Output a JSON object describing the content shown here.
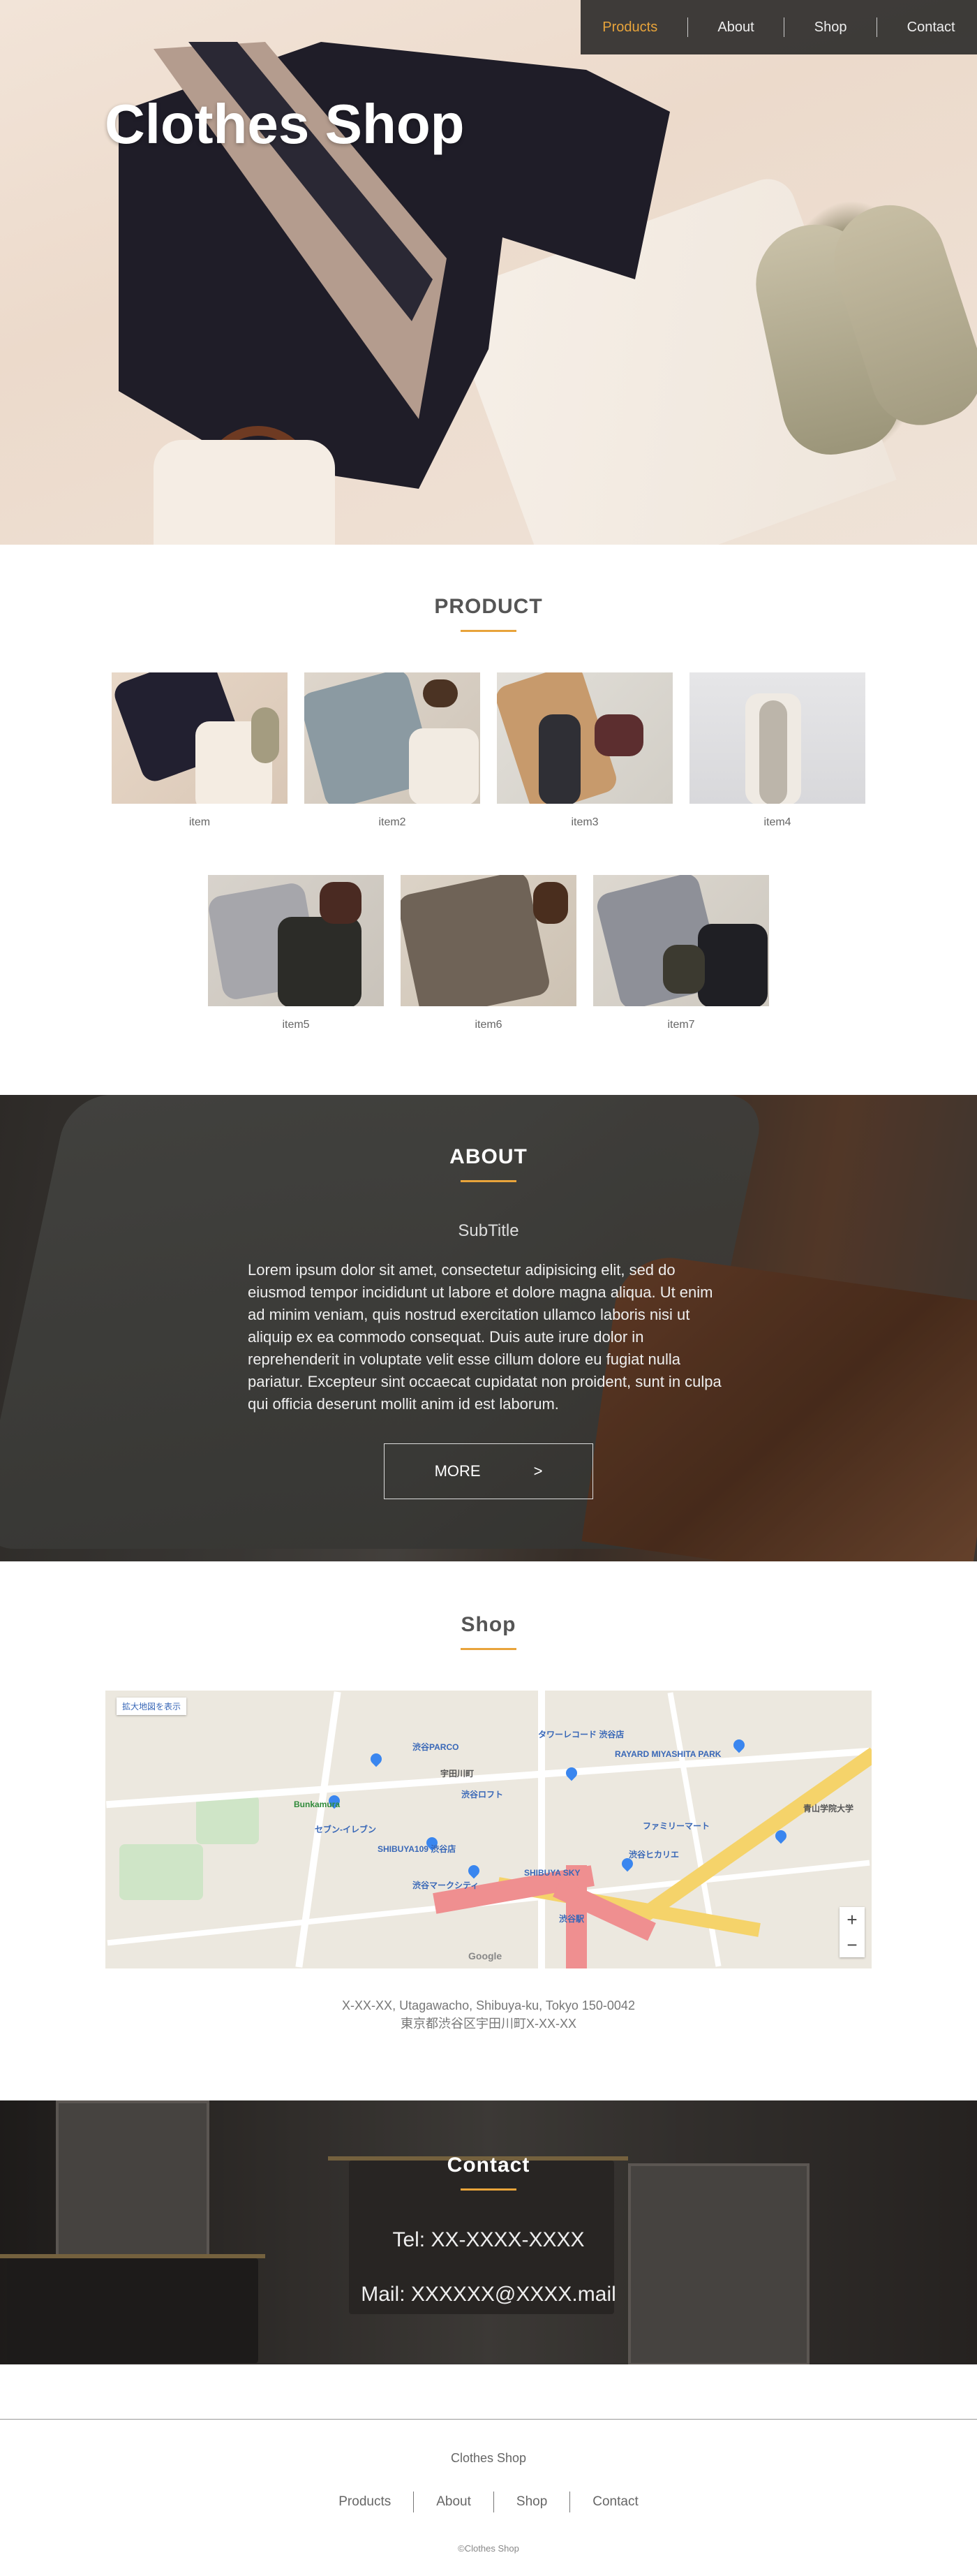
{
  "hero": {
    "title": "Clothes Shop"
  },
  "nav": {
    "items": [
      {
        "label": "Products",
        "active": true
      },
      {
        "label": "About",
        "active": false
      },
      {
        "label": "Shop",
        "active": false
      },
      {
        "label": "Contact",
        "active": false
      }
    ]
  },
  "product": {
    "title": "PRODUCT",
    "items": [
      {
        "caption": "item"
      },
      {
        "caption": "item2"
      },
      {
        "caption": "item3"
      },
      {
        "caption": "item4"
      },
      {
        "caption": "item5"
      },
      {
        "caption": "item6"
      },
      {
        "caption": "item7"
      }
    ]
  },
  "about": {
    "title": "ABOUT",
    "subtitle": "SubTitle",
    "body": "Lorem ipsum dolor sit amet, consectetur adipisicing elit, sed do eiusmod tempor incididunt ut labore et dolore magna aliqua. Ut enim ad minim veniam, quis nostrud exercitation ullamco laboris nisi ut aliquip ex ea commodo consequat. Duis aute irure dolor in reprehenderit in voluptate velit esse cillum dolore eu fugiat nulla pariatur. Excepteur sint occaecat cupidatat non proident, sunt in culpa qui officia deserunt mollit anim id est laborum.",
    "more_label": "MORE",
    "more_arrow": ">"
  },
  "shop": {
    "title": "Shop",
    "map": {
      "enlarge_label": "拡大地図を表示",
      "zoom_in": "+",
      "zoom_out": "−",
      "google_label": "Google",
      "labels": [
        "渋谷PARCO",
        "Bunkamura",
        "SHIBUYA109 渋谷店",
        "渋谷ロフト",
        "宇田川町",
        "RAYARD MIYASHITA PARK",
        "タワーレコード 渋谷店",
        "渋谷マークシティ",
        "SHIBUYA SKY",
        "渋谷ヒカリエ",
        "渋谷駅",
        "青山学院大学",
        "ファミリーマート",
        "セブン-イレブン"
      ]
    },
    "address_line1": "X-XX-XX, Utagawacho, Shibuya-ku, Tokyo 150-0042",
    "address_line2": "東京都渋谷区宇田川町X-XX-XX"
  },
  "contact": {
    "title": "Contact",
    "tel": "Tel: XX-XXXX-XXXX",
    "mail": "Mail: XXXXXX@XXXX.mail"
  },
  "footer": {
    "brand": "Clothes Shop",
    "nav": [
      "Products",
      "About",
      "Shop",
      "Contact"
    ],
    "copyright": "©Clothes Shop"
  },
  "colors": {
    "accent": "#e8a43b",
    "nav_bg": "#1e1e1e",
    "text": "#555555"
  }
}
